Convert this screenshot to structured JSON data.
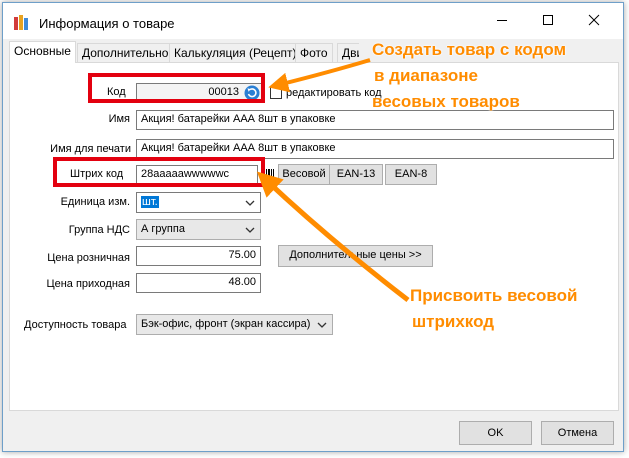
{
  "window": {
    "title": "Информация о товаре"
  },
  "tabs": [
    {
      "label": "Основные"
    },
    {
      "label": "Дополнительно"
    },
    {
      "label": "Калькуляция (Рецепт)"
    },
    {
      "label": "Фото"
    },
    {
      "label": "Движе"
    }
  ],
  "form": {
    "code_label": "Код",
    "code_value": "00013",
    "edit_code_label": "редактировать код",
    "name_label": "Имя",
    "name_value": "Акция! батарейки ААА 8шт в упаковке",
    "print_name_label": "Имя для печати",
    "print_name_value": "Акция! батарейки ААА 8шт в упаковке",
    "barcode_label": "Штрих код",
    "barcode_value": "28aaaaawwwwwc",
    "weight_btn": "Весовой",
    "ean13_btn": "EAN-13",
    "ean8_btn": "EAN-8",
    "unit_label": "Единица изм.",
    "unit_value": "шт.",
    "vat_label": "Группа НДС",
    "vat_value": "А группа",
    "retail_label": "Цена розничная",
    "retail_value": "75.00",
    "extra_prices_btn": "Дополнительные цены >>",
    "purchase_label": "Цена приходная",
    "purchase_value": "48.00",
    "availability_label": "Доступность товара",
    "availability_value": "Бэк-офис, фронт (экран кассира)"
  },
  "footer": {
    "ok": "OK",
    "cancel": "Отмена"
  },
  "annotations": {
    "top_line1": "Создать товар с кодом",
    "top_line2": "в диапазоне",
    "top_line3": "весовых товаров",
    "bottom_line1": "Присвоить весовой",
    "bottom_line2": "штрихкод"
  },
  "colors": {
    "highlight": "#e3000f",
    "annotation": "#ff8c00",
    "refresh_icon": "#2a7fd4"
  }
}
